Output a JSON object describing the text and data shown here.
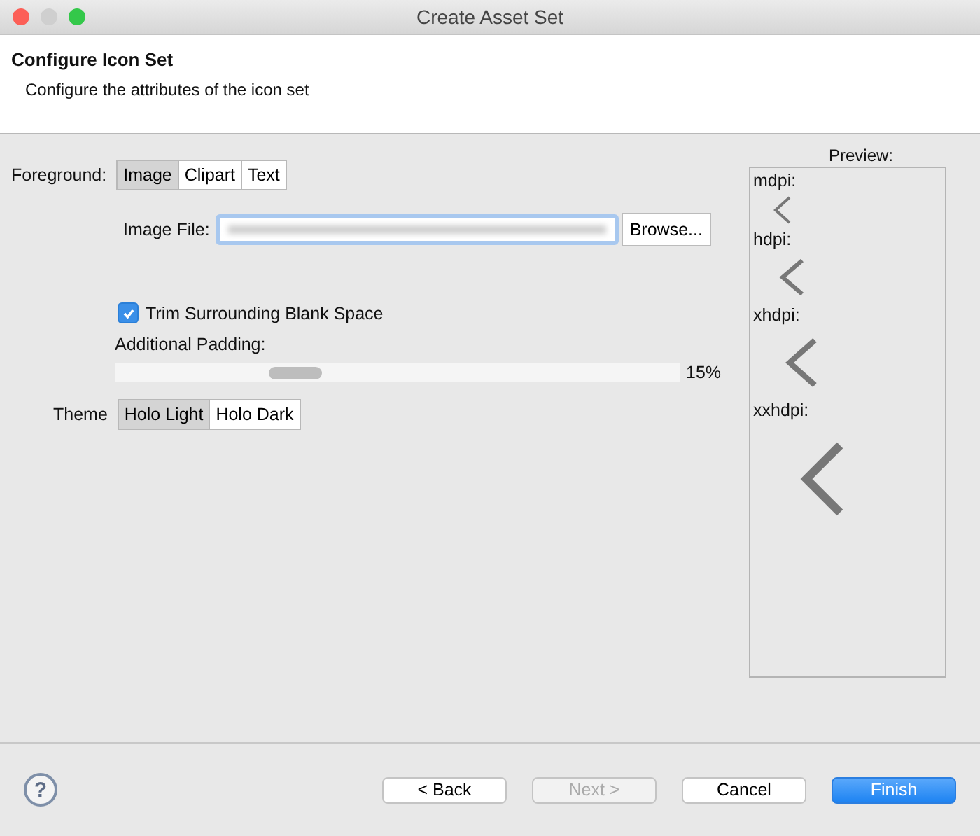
{
  "window": {
    "title": "Create Asset Set"
  },
  "header": {
    "title": "Configure Icon Set",
    "subtitle": "Configure the attributes of the icon set"
  },
  "foreground": {
    "label": "Foreground:",
    "options": [
      {
        "label": "Image",
        "selected": true
      },
      {
        "label": "Clipart",
        "selected": false
      },
      {
        "label": "Text",
        "selected": false
      }
    ]
  },
  "image_file": {
    "label": "Image File:",
    "browse": "Browse..."
  },
  "trim": {
    "label": "Trim Surrounding Blank Space",
    "checked": true
  },
  "padding": {
    "label": "Additional Padding:",
    "level": 0.3,
    "reading": "15%"
  },
  "theme": {
    "label": "Theme",
    "options": [
      {
        "label": "Holo Light",
        "selected": true
      },
      {
        "label": "Holo Dark",
        "selected": false
      }
    ]
  },
  "preview": {
    "title": "Preview:",
    "densities": [
      {
        "label": "mdpi:"
      },
      {
        "label": "hdpi:"
      },
      {
        "label": "xhdpi:"
      },
      {
        "label": "xxhdpi:"
      }
    ]
  },
  "footer": {
    "help": "?",
    "buttons": [
      {
        "label": "< Back",
        "kind": "normal",
        "disabled": false
      },
      {
        "label": "Next >",
        "kind": "normal",
        "disabled": true
      },
      {
        "label": "Cancel",
        "kind": "normal",
        "disabled": false
      },
      {
        "label": "Finish",
        "kind": "default",
        "disabled": false
      }
    ]
  }
}
